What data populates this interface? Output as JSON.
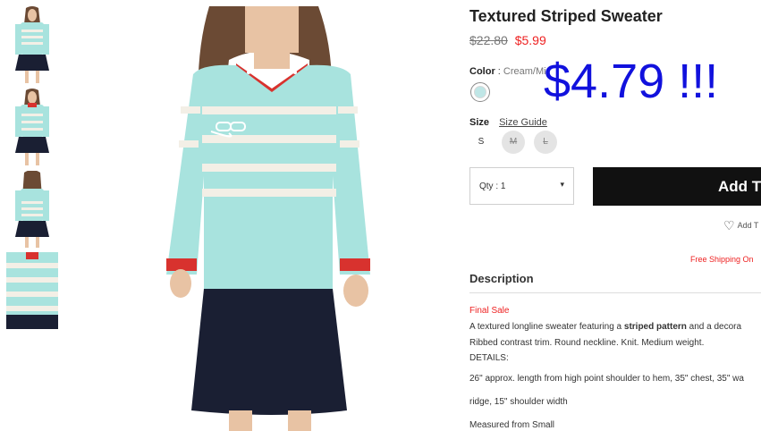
{
  "thumbnails": [
    {
      "name": "thumbnail-front"
    },
    {
      "name": "thumbnail-front-2"
    },
    {
      "name": "thumbnail-back"
    },
    {
      "name": "thumbnail-detail"
    }
  ],
  "product": {
    "title": "Textured Striped Sweater",
    "price_old": "$22.80",
    "price_new": "$5.99",
    "overlay_price": "$4.79 !!!",
    "color_label": "Color",
    "color_sep": ":",
    "color_value": "Cream/Mi",
    "swatch_color": "#bfe6e6",
    "size_label": "Size",
    "size_guide": "Size Guide",
    "sizes": [
      {
        "label": "S",
        "available": true
      },
      {
        "label": "M",
        "available": false
      },
      {
        "label": "L",
        "available": false
      }
    ],
    "qty_text": "Qty : 1",
    "qty_caret": "▾",
    "add_button": "Add T",
    "wishlist": "Add T",
    "free_shipping": "Free Shipping On"
  },
  "description": {
    "title": "Description",
    "final_sale": "Final Sale",
    "line1_pre": "A textured longline sweater featuring a ",
    "line1_bold": "striped pattern",
    "line1_post": " and a decora",
    "line2": "Ribbed contrast trim. Round neckline. Knit. Medium weight.",
    "line3": "DETAILS:",
    "line4": "26\" approx. length from high point shoulder to hem, 35\" chest, 35\" wa",
    "line5": "ridge, 15\" shoulder width",
    "line6": "Measured from Small"
  },
  "colors": {
    "accent_red": "#ee2222",
    "overlay_blue": "#1111dd",
    "sweater_mint": "#a8e3de",
    "stripe_cream": "#f3efe6",
    "skirt_navy": "#1a1f33"
  }
}
